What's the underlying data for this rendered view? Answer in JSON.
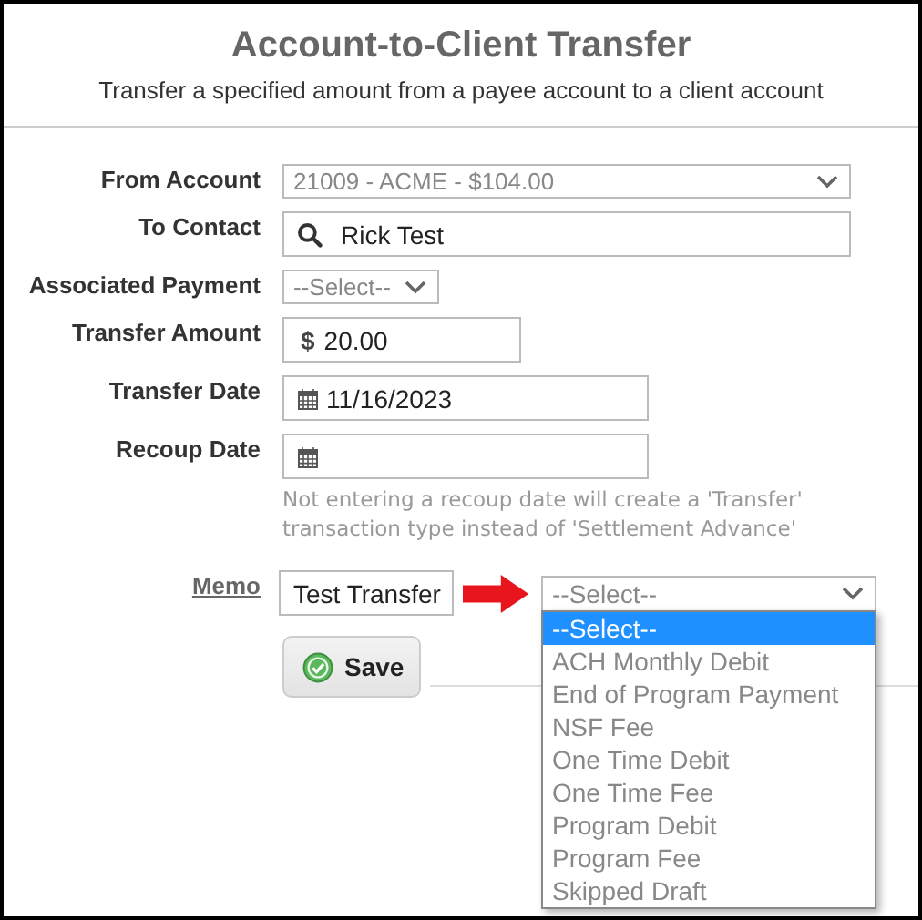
{
  "header": {
    "title": "Account-to-Client Transfer",
    "subtitle": "Transfer a specified amount from a payee account to a client account"
  },
  "fields": [
    {
      "label": "From Account",
      "kind": "select",
      "value": "21009 - ACME - $104.00",
      "wide": true
    },
    {
      "label": "To Contact",
      "kind": "search",
      "value": "Rick Test"
    },
    {
      "label": "Associated Payment",
      "kind": "select",
      "value": "--Select--",
      "wide": false
    },
    {
      "label": "Transfer Amount",
      "kind": "amount",
      "prefix": "$",
      "value": "20.00"
    },
    {
      "label": "Transfer Date",
      "kind": "date",
      "value": "11/16/2023"
    },
    {
      "label": "Recoup Date",
      "kind": "date",
      "note": "Not entering a recoup date will create a 'Transfer' transaction type instead of 'Settlement Advance'"
    }
  ],
  "memo": {
    "label": "Memo",
    "value": "Test Transfer",
    "type_select": {
      "value": "--Select--",
      "expanded": true,
      "options": [
        {
          "label": "--Select--",
          "selected": true
        },
        {
          "label": "ACH Monthly Debit",
          "selected": false
        },
        {
          "label": "End of Program Payment",
          "selected": false
        },
        {
          "label": "NSF Fee",
          "selected": false
        },
        {
          "label": "One Time Debit",
          "selected": false
        },
        {
          "label": "One Time Fee",
          "selected": false
        },
        {
          "label": "Program Debit",
          "selected": false
        },
        {
          "label": "Program Fee",
          "selected": false
        },
        {
          "label": "Skipped Draft",
          "selected": false
        }
      ]
    }
  },
  "save_button": "Save"
}
